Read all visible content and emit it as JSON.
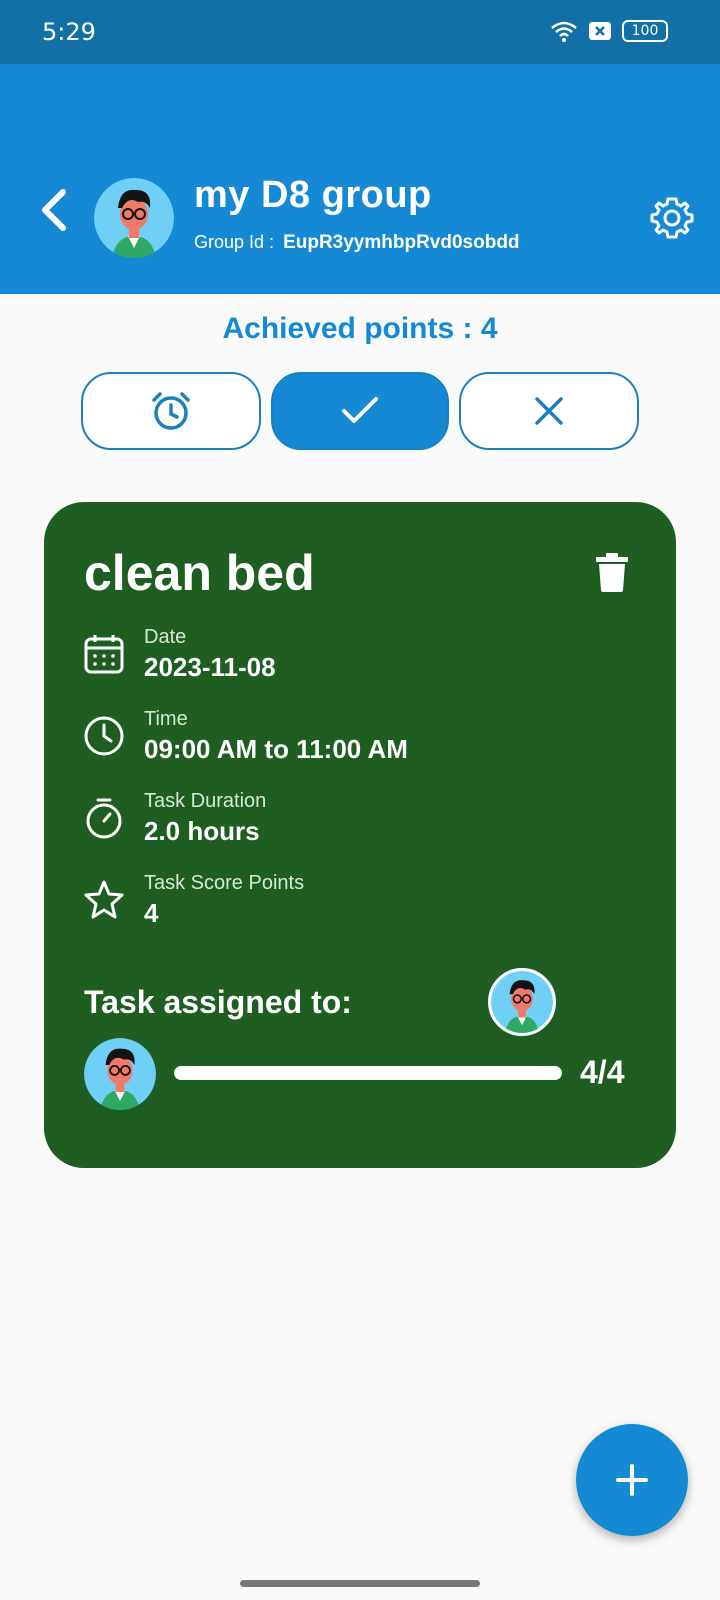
{
  "status_bar": {
    "time": "5:29",
    "battery": "100",
    "icons": [
      "wifi-icon",
      "sim-x-icon",
      "battery-icon"
    ]
  },
  "header": {
    "group_name": "my D8 group",
    "group_id_label": "Group Id :",
    "group_id_value": "EupR3yymhbpRvd0sobdd",
    "back_icon": "chevron-left-icon",
    "settings_icon": "gear-icon"
  },
  "summary": {
    "achieved_points": "Achieved points : 4"
  },
  "filters": [
    {
      "icon": "alarm-icon",
      "active": false
    },
    {
      "icon": "check-icon",
      "active": true
    },
    {
      "icon": "close-icon",
      "active": false
    }
  ],
  "task": {
    "title": "clean bed",
    "date_label": "Date",
    "date_value": "2023-11-08",
    "time_label": "Time",
    "time_value": "09:00 AM to 11:00 AM",
    "duration_label": "Task Duration",
    "duration_value": "2.0 hours",
    "points_label": "Task Score Points",
    "points_value": "4",
    "assigned_label": "Task assigned to:",
    "progress_text": "4/4",
    "progress_fraction": 1.0
  },
  "colors": {
    "status_bar": "#1270a6",
    "primary": "#1589d4",
    "card_green": "#1e5e20",
    "background": "#fafafa"
  }
}
